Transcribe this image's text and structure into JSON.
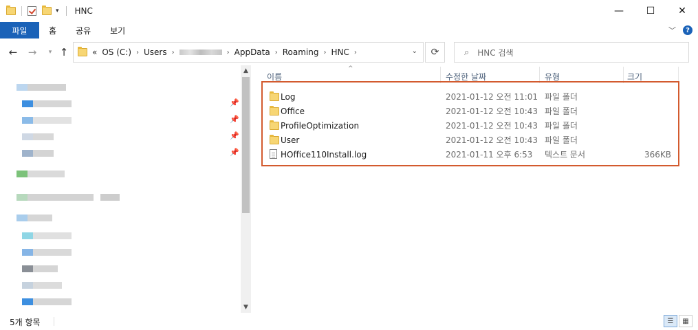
{
  "title_bar": {
    "title": "HNC",
    "controls": {
      "minimize": "—",
      "maximize": "☐",
      "close": "✕"
    }
  },
  "ribbon": {
    "file_tab": "파일",
    "tabs": [
      "홈",
      "공유",
      "보기"
    ]
  },
  "address": {
    "overflow": "«",
    "crumbs": [
      "OS (C:)",
      "Users",
      "AppData",
      "Roaming",
      "HNC"
    ]
  },
  "search": {
    "placeholder": "HNC 검색"
  },
  "columns": {
    "name": "이름",
    "date": "수정한 날짜",
    "type": "유형",
    "size": "크기"
  },
  "files": [
    {
      "name": "Log",
      "date": "2021-01-12 오전 11:01",
      "type": "파일 폴더",
      "size": "",
      "icon": "folder-icon"
    },
    {
      "name": "Office",
      "date": "2021-01-12 오전 10:43",
      "type": "파일 폴더",
      "size": "",
      "icon": "folder-icon"
    },
    {
      "name": "ProfileOptimization",
      "date": "2021-01-12 오전 10:43",
      "type": "파일 폴더",
      "size": "",
      "icon": "folder-icon"
    },
    {
      "name": "User",
      "date": "2021-01-12 오전 10:43",
      "type": "파일 폴더",
      "size": "",
      "icon": "folder-icon"
    },
    {
      "name": "HOffice110Install.log",
      "date": "2021-01-11 오후 6:53",
      "type": "텍스트 문서",
      "size": "366KB",
      "icon": "text-file-icon"
    }
  ],
  "status": {
    "item_count": "5개 항목"
  },
  "colors": {
    "accent": "#1a62b8",
    "highlight_border": "#d35a2e",
    "folder": "#f7d674"
  }
}
